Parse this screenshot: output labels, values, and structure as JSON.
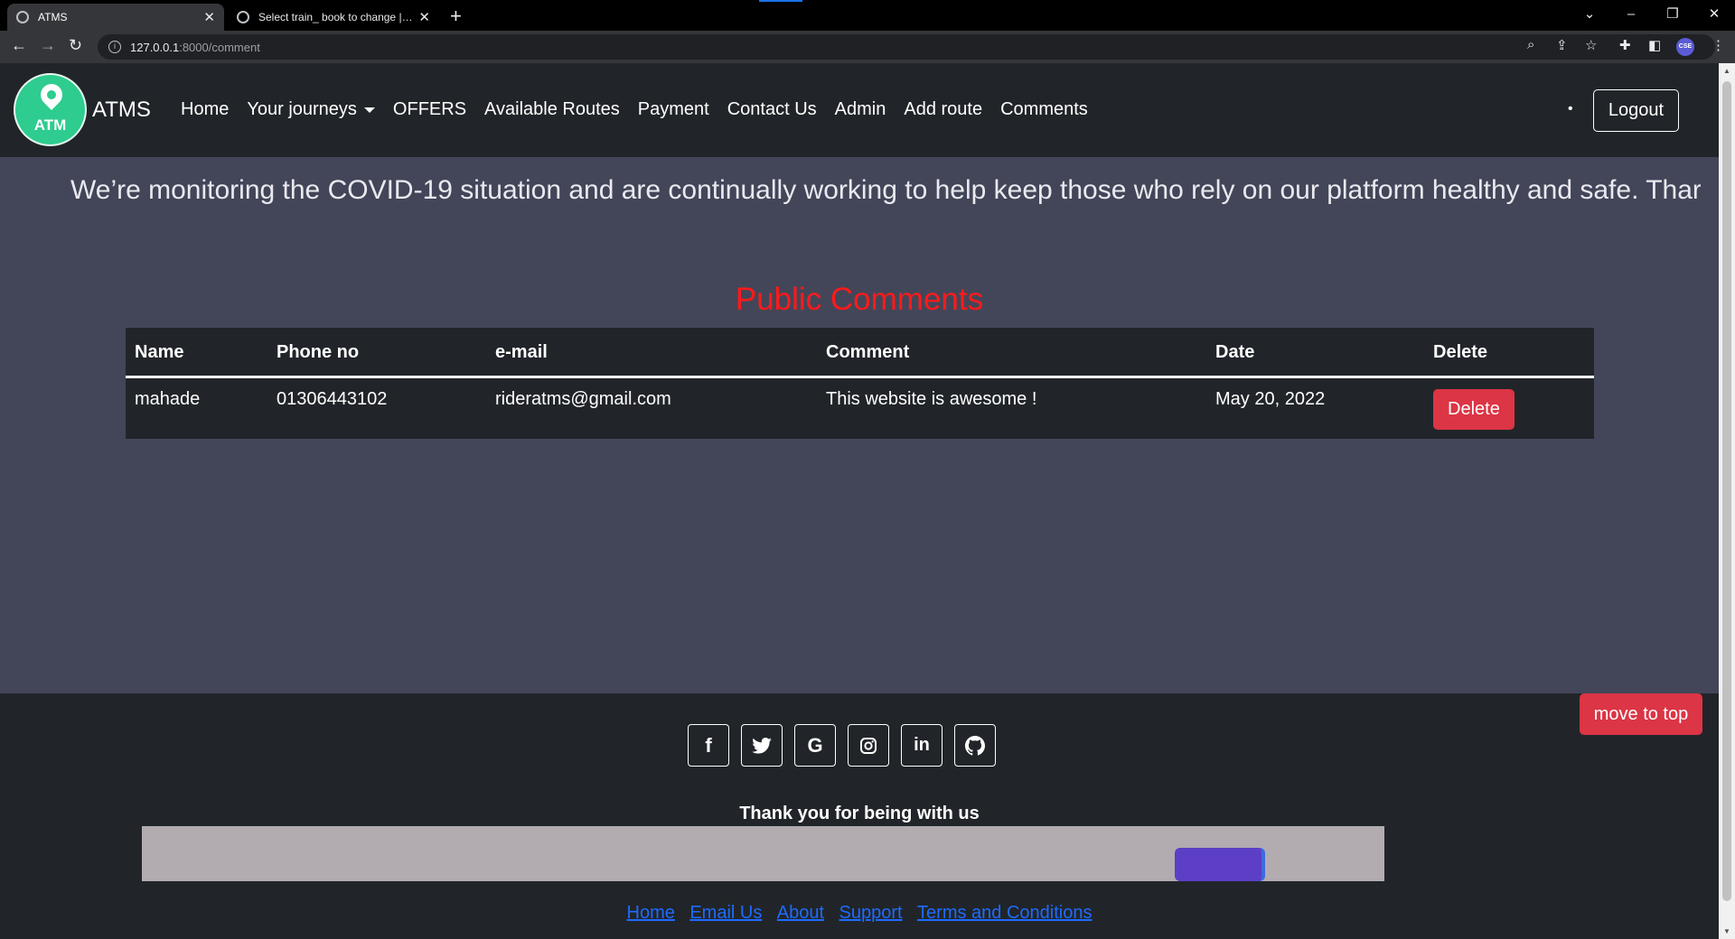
{
  "browser": {
    "tabs": [
      {
        "title": "ATMS",
        "active": true
      },
      {
        "title": "Select train_ book to change | Dj",
        "active": false
      }
    ],
    "url_host": "127.0.0.1",
    "url_path": ":8000/comment",
    "profile_label": "CSE"
  },
  "navbar": {
    "logo_text": "ATM",
    "brand": "ATMS",
    "links": [
      "Home",
      "Your journeys",
      "OFFERS",
      "Available Routes",
      "Payment",
      "Contact Us",
      "Admin",
      "Add route",
      "Comments"
    ],
    "logout": "Logout"
  },
  "notice": "We’re monitoring the COVID-19 situation and are continually working to help keep those who rely on our platform healthy and safe. Thar",
  "comments": {
    "title": "Public Comments",
    "headers": [
      "Name",
      "Phone no",
      "e-mail",
      "Comment",
      "Date",
      "Delete"
    ],
    "rows": [
      {
        "name": "mahade",
        "phone": "01306443102",
        "email": "rideratms@gmail.com",
        "comment": "This website is awesome !",
        "date": "May 20, 2022",
        "action": "Delete"
      }
    ]
  },
  "footer": {
    "social_icons": [
      "facebook-icon",
      "twitter-icon",
      "google-icon",
      "instagram-icon",
      "linkedin-icon",
      "github-icon"
    ],
    "move_to_top": "move to top",
    "thanks": "Thank you for being with us",
    "links": [
      "Home",
      "Email Us",
      "About",
      "Support",
      "Terms and Conditions"
    ]
  },
  "colors": {
    "page_bg": "#434659",
    "nav_bg": "#212529",
    "title_red": "#ff1a1a",
    "danger": "#dc3545",
    "link_blue": "#1e6bff"
  }
}
